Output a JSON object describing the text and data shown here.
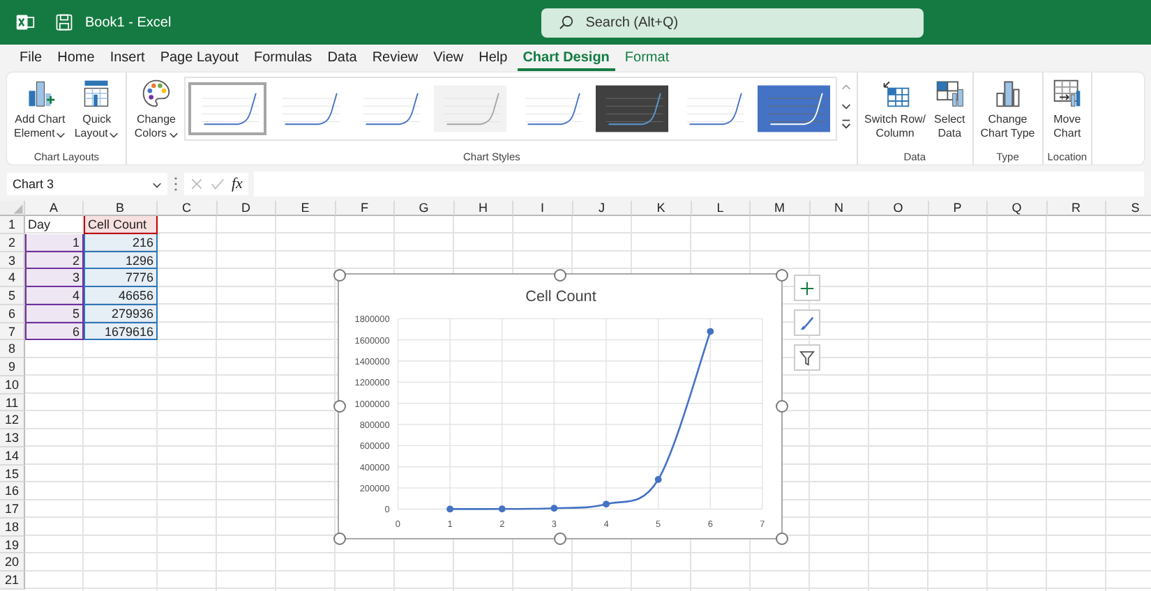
{
  "window": {
    "title": "Book1 - Excel",
    "search": {
      "placeholder": "Search (Alt+Q)"
    }
  },
  "menu_tabs": [
    {
      "label": "File",
      "selected": false,
      "contextual": false
    },
    {
      "label": "Home",
      "selected": false,
      "contextual": false
    },
    {
      "label": "Insert",
      "selected": false,
      "contextual": false
    },
    {
      "label": "Page Layout",
      "selected": false,
      "contextual": false
    },
    {
      "label": "Formulas",
      "selected": false,
      "contextual": false
    },
    {
      "label": "Data",
      "selected": false,
      "contextual": false
    },
    {
      "label": "Review",
      "selected": false,
      "contextual": false
    },
    {
      "label": "View",
      "selected": false,
      "contextual": false
    },
    {
      "label": "Help",
      "selected": false,
      "contextual": false
    },
    {
      "label": "Chart Design",
      "selected": true,
      "contextual": true
    },
    {
      "label": "Format",
      "selected": false,
      "contextual": true
    }
  ],
  "ribbon": {
    "groups": [
      {
        "label": "Chart Layouts",
        "buttons": [
          {
            "kind": "add-element",
            "lines": [
              "Add Chart",
              "Element"
            ],
            "dropdown": true
          },
          {
            "kind": "quick-layout",
            "lines": [
              "Quick",
              "Layout"
            ],
            "dropdown": true
          }
        ]
      },
      {
        "label": "Chart Styles",
        "buttons": [
          {
            "kind": "palette",
            "lines": [
              "Change",
              "Colors"
            ],
            "dropdown": true
          }
        ],
        "styles": [
          {
            "kind": "light",
            "selected": true
          },
          {
            "kind": "light",
            "selected": false
          },
          {
            "kind": "light",
            "selected": false
          },
          {
            "kind": "grey",
            "selected": false
          },
          {
            "kind": "light",
            "selected": false
          },
          {
            "kind": "dark",
            "selected": false
          },
          {
            "kind": "light",
            "selected": false
          },
          {
            "kind": "blue",
            "selected": false
          }
        ]
      },
      {
        "label": "Data",
        "buttons": [
          {
            "kind": "switch",
            "lines": [
              "Switch Row/",
              "Column"
            ],
            "dropdown": false
          },
          {
            "kind": "select-data",
            "lines": [
              "Select",
              "Data"
            ],
            "dropdown": false
          }
        ]
      },
      {
        "label": "Type",
        "buttons": [
          {
            "kind": "chart-type",
            "lines": [
              "Change",
              "Chart Type"
            ],
            "dropdown": false
          }
        ]
      },
      {
        "label": "Location",
        "buttons": [
          {
            "kind": "move-chart",
            "lines": [
              "Move",
              "Chart"
            ],
            "dropdown": false
          }
        ]
      }
    ]
  },
  "formula_bar": {
    "name_box": "Chart 3",
    "function_label": "fx"
  },
  "sheet": {
    "columns": [
      "A",
      "B",
      "C",
      "D",
      "E",
      "F",
      "G",
      "H",
      "I",
      "J",
      "K",
      "L",
      "M",
      "N",
      "O",
      "P",
      "Q",
      "R",
      "S"
    ],
    "rows": [
      {
        "header": "1",
        "cells": [
          {
            "text": "Day",
            "kind": "text"
          },
          {
            "text": "Cell Count",
            "kind": "text",
            "color": "#c00000"
          }
        ]
      },
      {
        "header": "2",
        "cells": [
          {
            "text": "1",
            "kind": "number",
            "color": "#7030a0"
          },
          {
            "text": "216",
            "kind": "number",
            "color": "#2e75b6"
          }
        ]
      },
      {
        "header": "3",
        "cells": [
          {
            "text": "2",
            "kind": "number",
            "color": "#7030a0"
          },
          {
            "text": "1296",
            "kind": "number",
            "color": "#2e75b6"
          }
        ]
      },
      {
        "header": "4",
        "cells": [
          {
            "text": "3",
            "kind": "number",
            "color": "#7030a0"
          },
          {
            "text": "7776",
            "kind": "number",
            "color": "#2e75b6"
          }
        ]
      },
      {
        "header": "5",
        "cells": [
          {
            "text": "4",
            "kind": "number",
            "color": "#7030a0"
          },
          {
            "text": "46656",
            "kind": "number",
            "color": "#2e75b6"
          }
        ]
      },
      {
        "header": "6",
        "cells": [
          {
            "text": "5",
            "kind": "number",
            "color": "#7030a0"
          },
          {
            "text": "279936",
            "kind": "number",
            "color": "#2e75b6"
          }
        ]
      },
      {
        "header": "7",
        "cells": [
          {
            "text": "6",
            "kind": "number",
            "color": "#7030a0"
          },
          {
            "text": "1679616",
            "kind": "number",
            "color": "#2e75b6"
          }
        ]
      },
      {
        "header": "8"
      },
      {
        "header": "9"
      },
      {
        "header": "10"
      },
      {
        "header": "11"
      },
      {
        "header": "12"
      },
      {
        "header": "13"
      },
      {
        "header": "14"
      },
      {
        "header": "15"
      },
      {
        "header": "16"
      },
      {
        "header": "17"
      },
      {
        "header": "18"
      },
      {
        "header": "19"
      },
      {
        "header": "20"
      },
      {
        "header": "21"
      }
    ]
  },
  "chart": {
    "chart_data": {
      "type": "line",
      "grid": true,
      "title": "Cell Count",
      "x": [
        1,
        2,
        3,
        4,
        5,
        6
      ],
      "series": [
        {
          "color": "#4472c4",
          "marker": true,
          "values": [
            216,
            1296,
            7776,
            46656,
            279936,
            1679616
          ]
        }
      ],
      "xlim": [
        0,
        7
      ],
      "ylim": [
        0,
        1800000
      ],
      "xticks": [
        0,
        1,
        2,
        3,
        4,
        5,
        6,
        7
      ],
      "yticks": [
        0,
        200000,
        400000,
        600000,
        800000,
        1000000,
        1200000,
        1400000,
        1600000,
        1800000
      ]
    }
  }
}
